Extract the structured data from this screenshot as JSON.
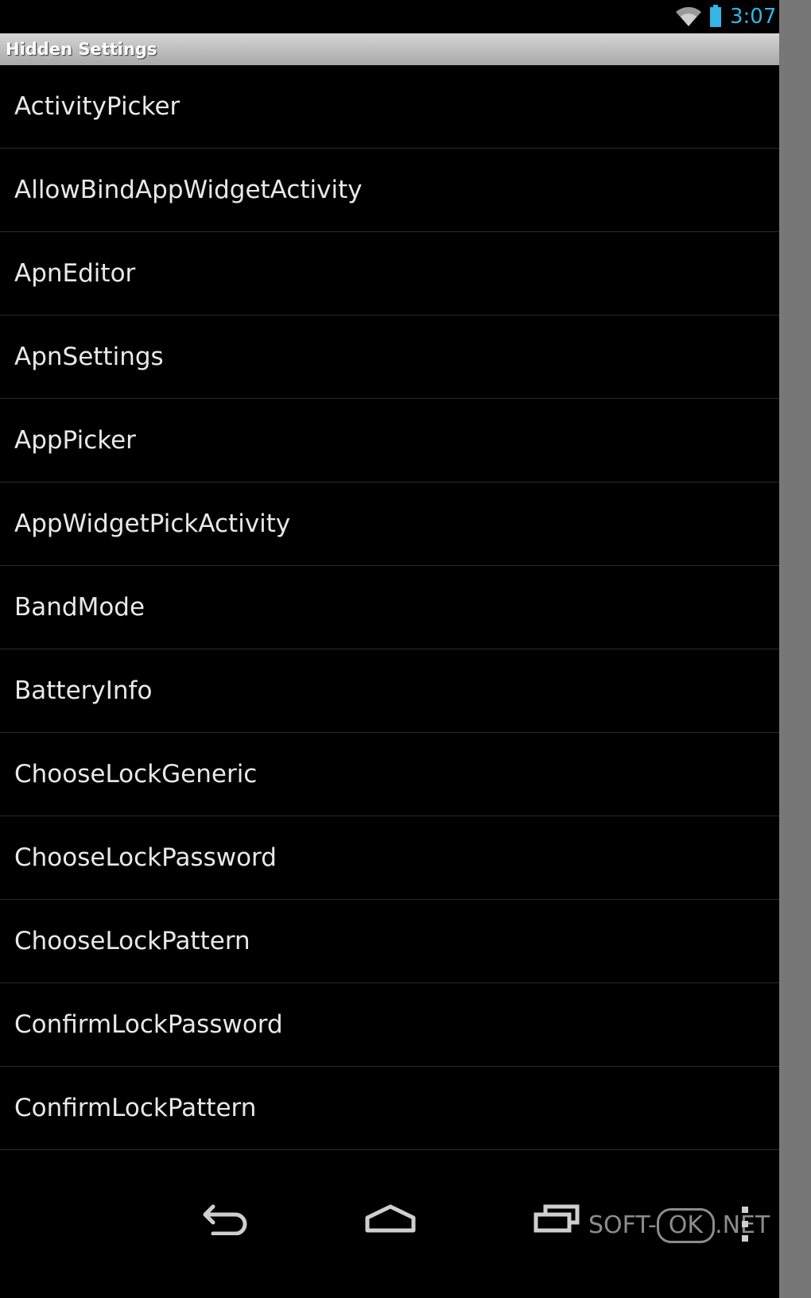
{
  "status_bar": {
    "time": "3:07",
    "icons": [
      "wifi-icon",
      "battery-icon"
    ],
    "time_color": "#33b5e5"
  },
  "header": {
    "title": "Hidden Settings"
  },
  "list": {
    "items": [
      {
        "label": "ActivityPicker"
      },
      {
        "label": "AllowBindAppWidgetActivity"
      },
      {
        "label": "ApnEditor"
      },
      {
        "label": "ApnSettings"
      },
      {
        "label": "AppPicker"
      },
      {
        "label": "AppWidgetPickActivity"
      },
      {
        "label": "BandMode"
      },
      {
        "label": "BatteryInfo"
      },
      {
        "label": "ChooseLockGeneric"
      },
      {
        "label": "ChooseLockPassword"
      },
      {
        "label": "ChooseLockPattern"
      },
      {
        "label": "ConfirmLockPassword"
      },
      {
        "label": "ConfirmLockPattern"
      }
    ]
  },
  "nav_bar": {
    "buttons": [
      "back-icon",
      "home-icon",
      "recents-icon",
      "menu-icon"
    ]
  },
  "watermark": {
    "prefix": "SOFT-",
    "boxed": "OK",
    "suffix": ".NET"
  }
}
